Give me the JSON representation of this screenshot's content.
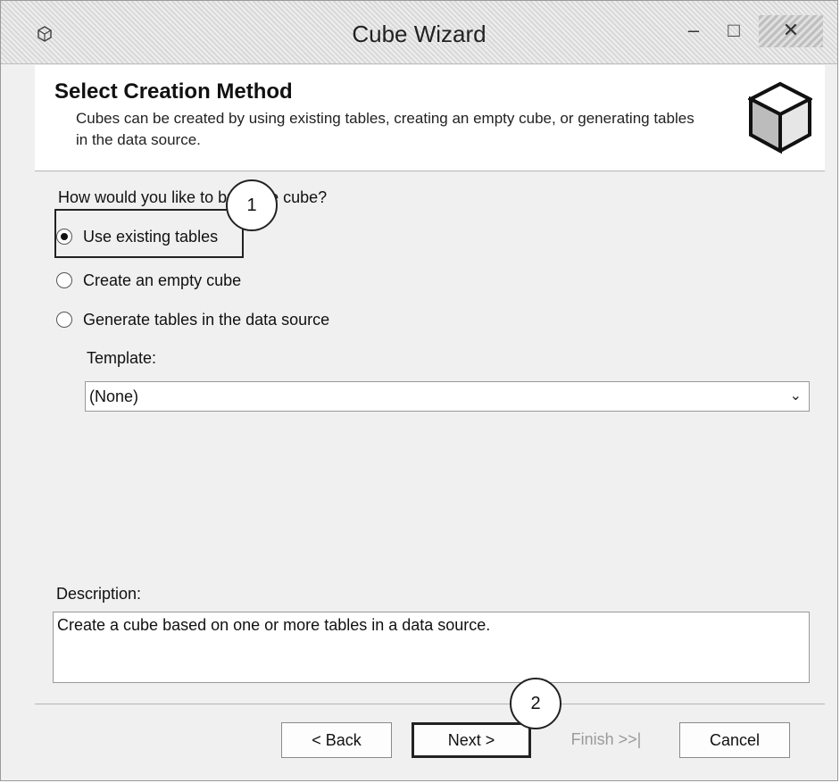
{
  "window": {
    "title": "Cube Wizard",
    "minimize_glyph": "–",
    "maximize_glyph": "□",
    "close_glyph": "✕"
  },
  "header": {
    "title": "Select Creation Method",
    "description": "Cubes can be created by using existing tables, creating an empty cube, or generating tables in the data source."
  },
  "main": {
    "question": "How would you like to build the cube?",
    "options": [
      {
        "label": "Use existing tables",
        "selected": true
      },
      {
        "label": "Create an empty cube",
        "selected": false
      },
      {
        "label": "Generate tables in the data source",
        "selected": false
      }
    ],
    "template_label": "Template:",
    "template_value": "(None)",
    "description_label": "Description:",
    "description_text": "Create a cube based on one or more tables in a data source."
  },
  "callouts": {
    "first": "1",
    "second": "2"
  },
  "footer": {
    "back_label": "< Back",
    "next_label": "Next >",
    "finish_label": "Finish >>|",
    "cancel_label": "Cancel"
  },
  "icons": {
    "app": "cube-app-icon",
    "header": "cube-icon",
    "dropdown": "chevron-down-icon"
  }
}
